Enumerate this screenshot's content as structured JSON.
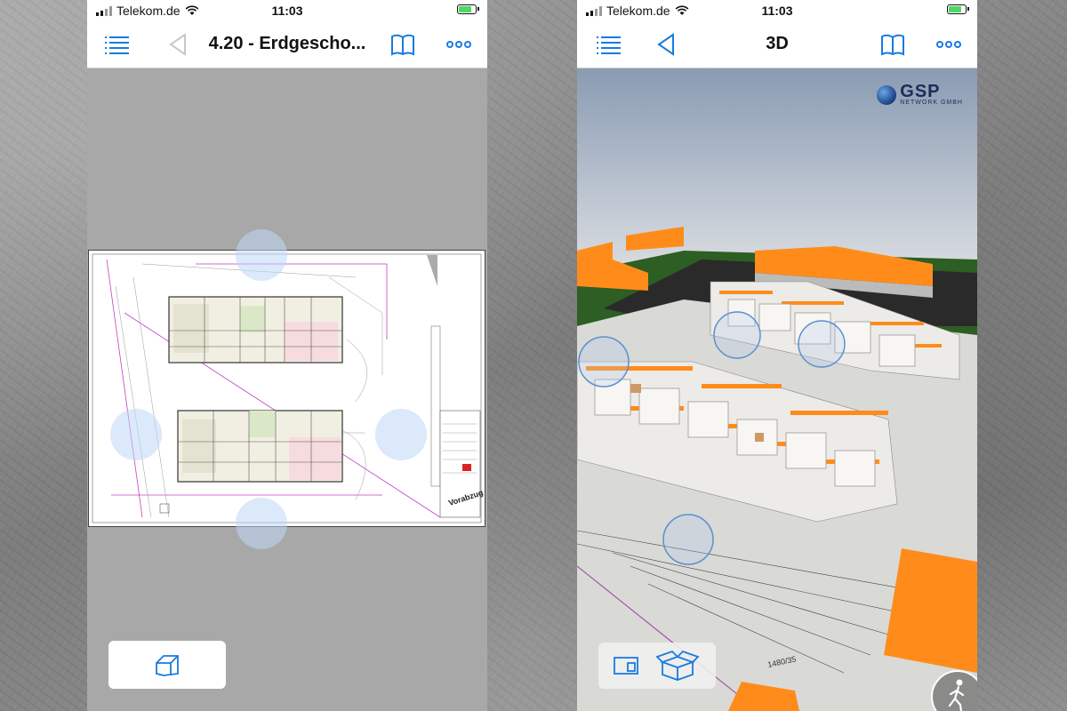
{
  "status_bar": {
    "carrier": "Telekom.de",
    "time": "11:03"
  },
  "left_screen": {
    "nav": {
      "title": "4.20 - Erdgescho...",
      "menu_icon": "list-icon",
      "back_icon": "back-triangle-icon",
      "book_icon": "book-icon",
      "more_icon": "more-dots-icon"
    },
    "plan_stamp": "Vorabzug",
    "bottom_toolbar": {
      "view_3d_icon": "cube-house-icon"
    }
  },
  "right_screen": {
    "nav": {
      "title": "3D",
      "menu_icon": "list-icon",
      "back_icon": "back-triangle-icon",
      "book_icon": "book-icon",
      "more_icon": "more-dots-icon"
    },
    "logo": {
      "name": "GSP",
      "sub": "NETWORK GMBH"
    },
    "dimension_label": "1480/35",
    "bottom_toolbar": {
      "plan_view_icon": "plan-card-icon",
      "model_view_icon": "open-box-icon"
    },
    "walk_icon": "walking-person-icon"
  },
  "colors": {
    "ios_blue": "#1a7ae0",
    "roof_orange": "#ff8c1a",
    "grass_green": "#2d5e23"
  }
}
